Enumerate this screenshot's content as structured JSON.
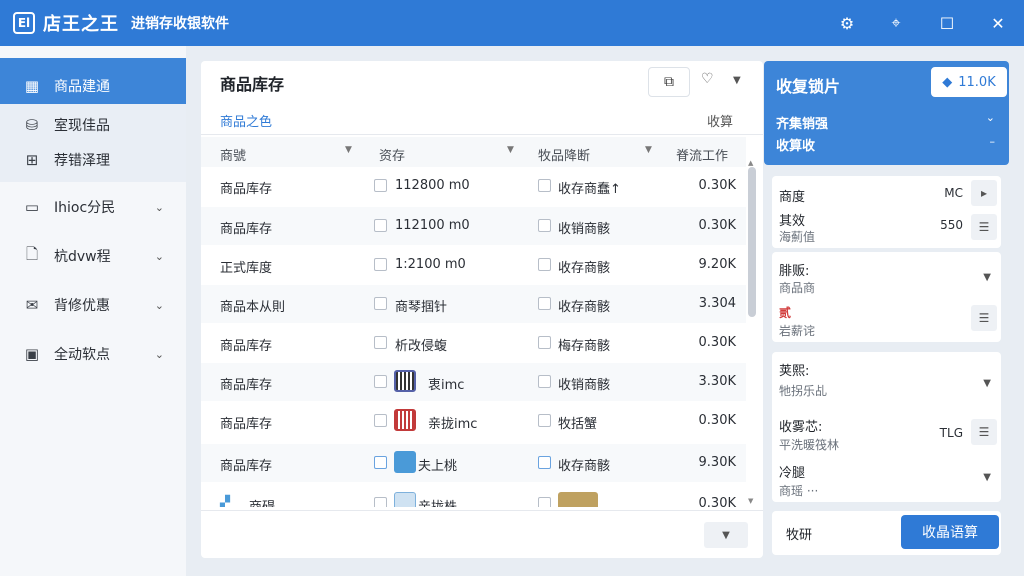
{
  "app": {
    "title": "店王之王",
    "subtitle": "进销存收银软件",
    "logo_text": "El",
    "window_icons": [
      "settings-icon",
      "target-icon",
      "maximize-icon",
      "close-icon"
    ]
  },
  "sidebar": {
    "items": [
      {
        "label": "商品建通",
        "icon": "grid-icon",
        "active": true
      },
      {
        "label": "室现佳品",
        "icon": "database-icon",
        "sub": true
      },
      {
        "label": "荐错泽理",
        "icon": "apps-icon",
        "sub": true
      },
      {
        "label": "Ihioc分民",
        "icon": "laptop-icon",
        "chevron": true
      },
      {
        "label": "杭dvw程",
        "icon": "file-icon",
        "chevron": true
      },
      {
        "label": "背修优惠",
        "icon": "mail-icon",
        "chevron": true
      },
      {
        "label": "全动软点",
        "icon": "calendar-icon",
        "chevron": true
      }
    ]
  },
  "main": {
    "title": "商品库存",
    "tabs": {
      "active": "商品之色",
      "right": "收算"
    },
    "columns": [
      "商號",
      "资存",
      "牧品降断",
      "脊流工作"
    ],
    "rows": [
      {
        "name": "商品库存",
        "spec": "112800 m0",
        "status": "收存商蠢↑",
        "value": "0.30K"
      },
      {
        "name": "商品库存",
        "spec": "112100 m0",
        "status": "收销商骸",
        "value": "0.30K"
      },
      {
        "name": "正式库度",
        "spec": "1:2100 m0",
        "status": "收存商骸",
        "value": "9.20K"
      },
      {
        "name": "商品本从則",
        "spec": "商琴掴针",
        "status": "收存商骸",
        "value": "3.304"
      },
      {
        "name": "商品库存",
        "spec": "析改侵蝮",
        "status": "梅存商骸",
        "value": "0.30K"
      },
      {
        "name": "商品库存",
        "spec": "衷imc",
        "status": "收销商骸",
        "value": "3.30K",
        "thumb": "barcode"
      },
      {
        "name": "商品库存",
        "spec": "亲拢imc",
        "status": "牧括蟹",
        "value": "0.30K",
        "thumb": "red-barcode"
      },
      {
        "name": "商品库存",
        "spec": "夫上桃",
        "status": "收存商骸",
        "value": "9.30K",
        "thumb": "blue-box"
      },
      {
        "name": "商碍",
        "spec": "亲拢株",
        "status": "",
        "value": "0.30K",
        "thumb": "partial"
      }
    ]
  },
  "right": {
    "title": "收复锁片",
    "button_label": "11.0K",
    "line1": "齐集销强",
    "line2": "收算收",
    "card1": [
      {
        "label": "商度",
        "value": "MC"
      },
      {
        "label": "其效",
        "sub": "海薊值",
        "value": "550"
      }
    ],
    "card2": {
      "label": "腓贩:",
      "sub": "商品商",
      "tag": "贰",
      "sub2": "岩薪诧"
    },
    "card3": [
      {
        "label": "荚熙:",
        "sub": "牠拐乐乩"
      },
      {
        "label": "收雾芯:",
        "sub": "平洗暖筏林",
        "value": "TLG"
      },
      {
        "label": "冷腿",
        "sub": "商瑶 ···"
      }
    ],
    "footer_label": "牧研",
    "footer_button": "收晶语算"
  },
  "colors": {
    "accent": "#2f7ad6",
    "sidebar_active": "#3d85d8",
    "background": "#e8edf3"
  }
}
